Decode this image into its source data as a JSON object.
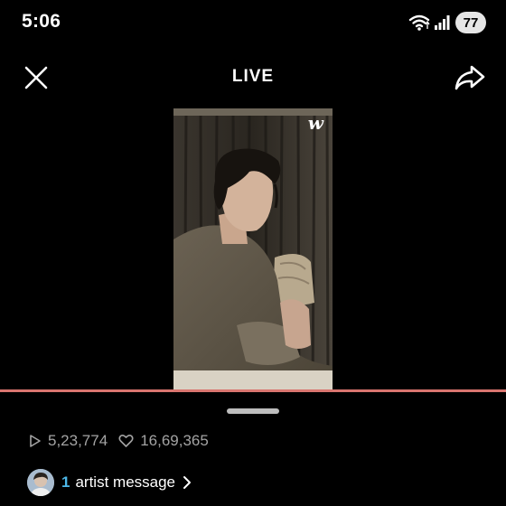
{
  "status_bar": {
    "time": "5:06",
    "battery": "77"
  },
  "header": {
    "title": "LIVE",
    "close_icon": "close-icon",
    "share_icon": "share-icon"
  },
  "video": {
    "logo": "w"
  },
  "stats": {
    "views": "5,23,774",
    "likes": "16,69,365"
  },
  "artist_message": {
    "count": "1",
    "label": "artist message"
  },
  "colors": {
    "progress": "#d9756f",
    "accent": "#4db8e8",
    "muted_text": "#a3a3a3"
  }
}
